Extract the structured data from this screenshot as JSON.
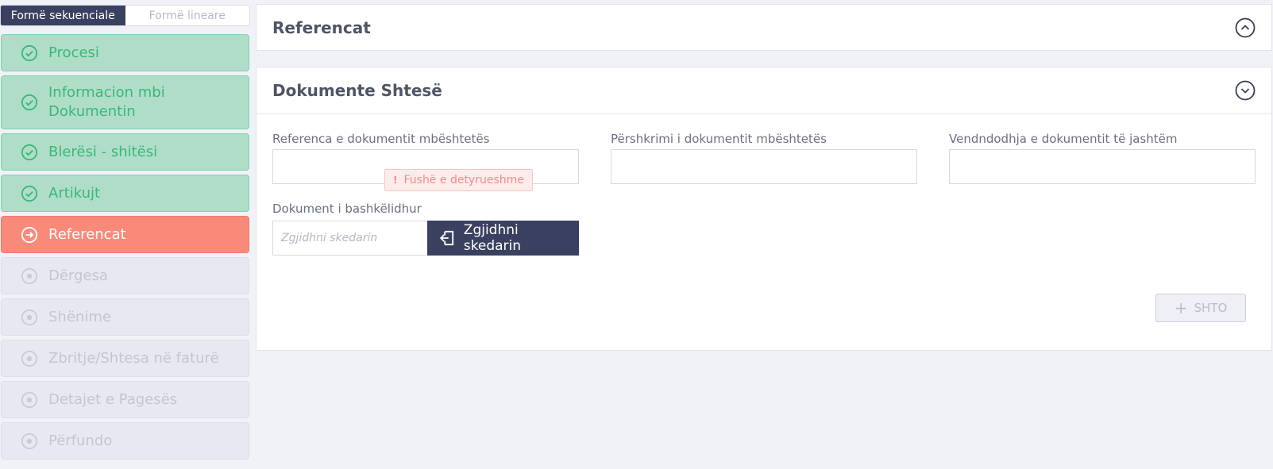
{
  "modes": {
    "sequential": "Formë sekuenciale",
    "linear": "Formë lineare"
  },
  "steps": [
    {
      "label": "Procesi",
      "status": "done"
    },
    {
      "label": "Informacion mbi Dokumentin",
      "status": "done"
    },
    {
      "label": "Blerësi - shitësi",
      "status": "done"
    },
    {
      "label": "Artikujt",
      "status": "done"
    },
    {
      "label": "Referencat",
      "status": "active"
    },
    {
      "label": "Dërgesa",
      "status": "pending"
    },
    {
      "label": "Shënime",
      "status": "pending"
    },
    {
      "label": "Zbritje/Shtesa në faturë",
      "status": "pending"
    },
    {
      "label": "Detajet e Pagesës",
      "status": "pending"
    },
    {
      "label": "Përfundo",
      "status": "pending"
    }
  ],
  "panels": {
    "references": {
      "title": "Referencat"
    },
    "additional": {
      "title": "Dokumente Shtesë",
      "fields": {
        "reference_label": "Referenca e dokumentit mbështetës",
        "reference_value": "",
        "description_label": "Përshkrimi i dokumentit mbështetës",
        "description_value": "",
        "location_label": "Vendndodhja e dokumentit të jashtëm",
        "location_value": "",
        "attachment_label": "Dokument i bashkëlidhur",
        "attachment_placeholder": "Zgjidhni skedarin",
        "choose_button": "Zgjidhni skedarin"
      },
      "error": "Fushë e detyrueshme",
      "add_button": "SHTO"
    }
  },
  "colors": {
    "done_bg": "#b0ddc8",
    "done_text": "#36b97a",
    "active_bg": "#f98a7a",
    "pending_bg": "#e7e8f2",
    "dark": "#3a4160",
    "error": "#f48a8a"
  }
}
